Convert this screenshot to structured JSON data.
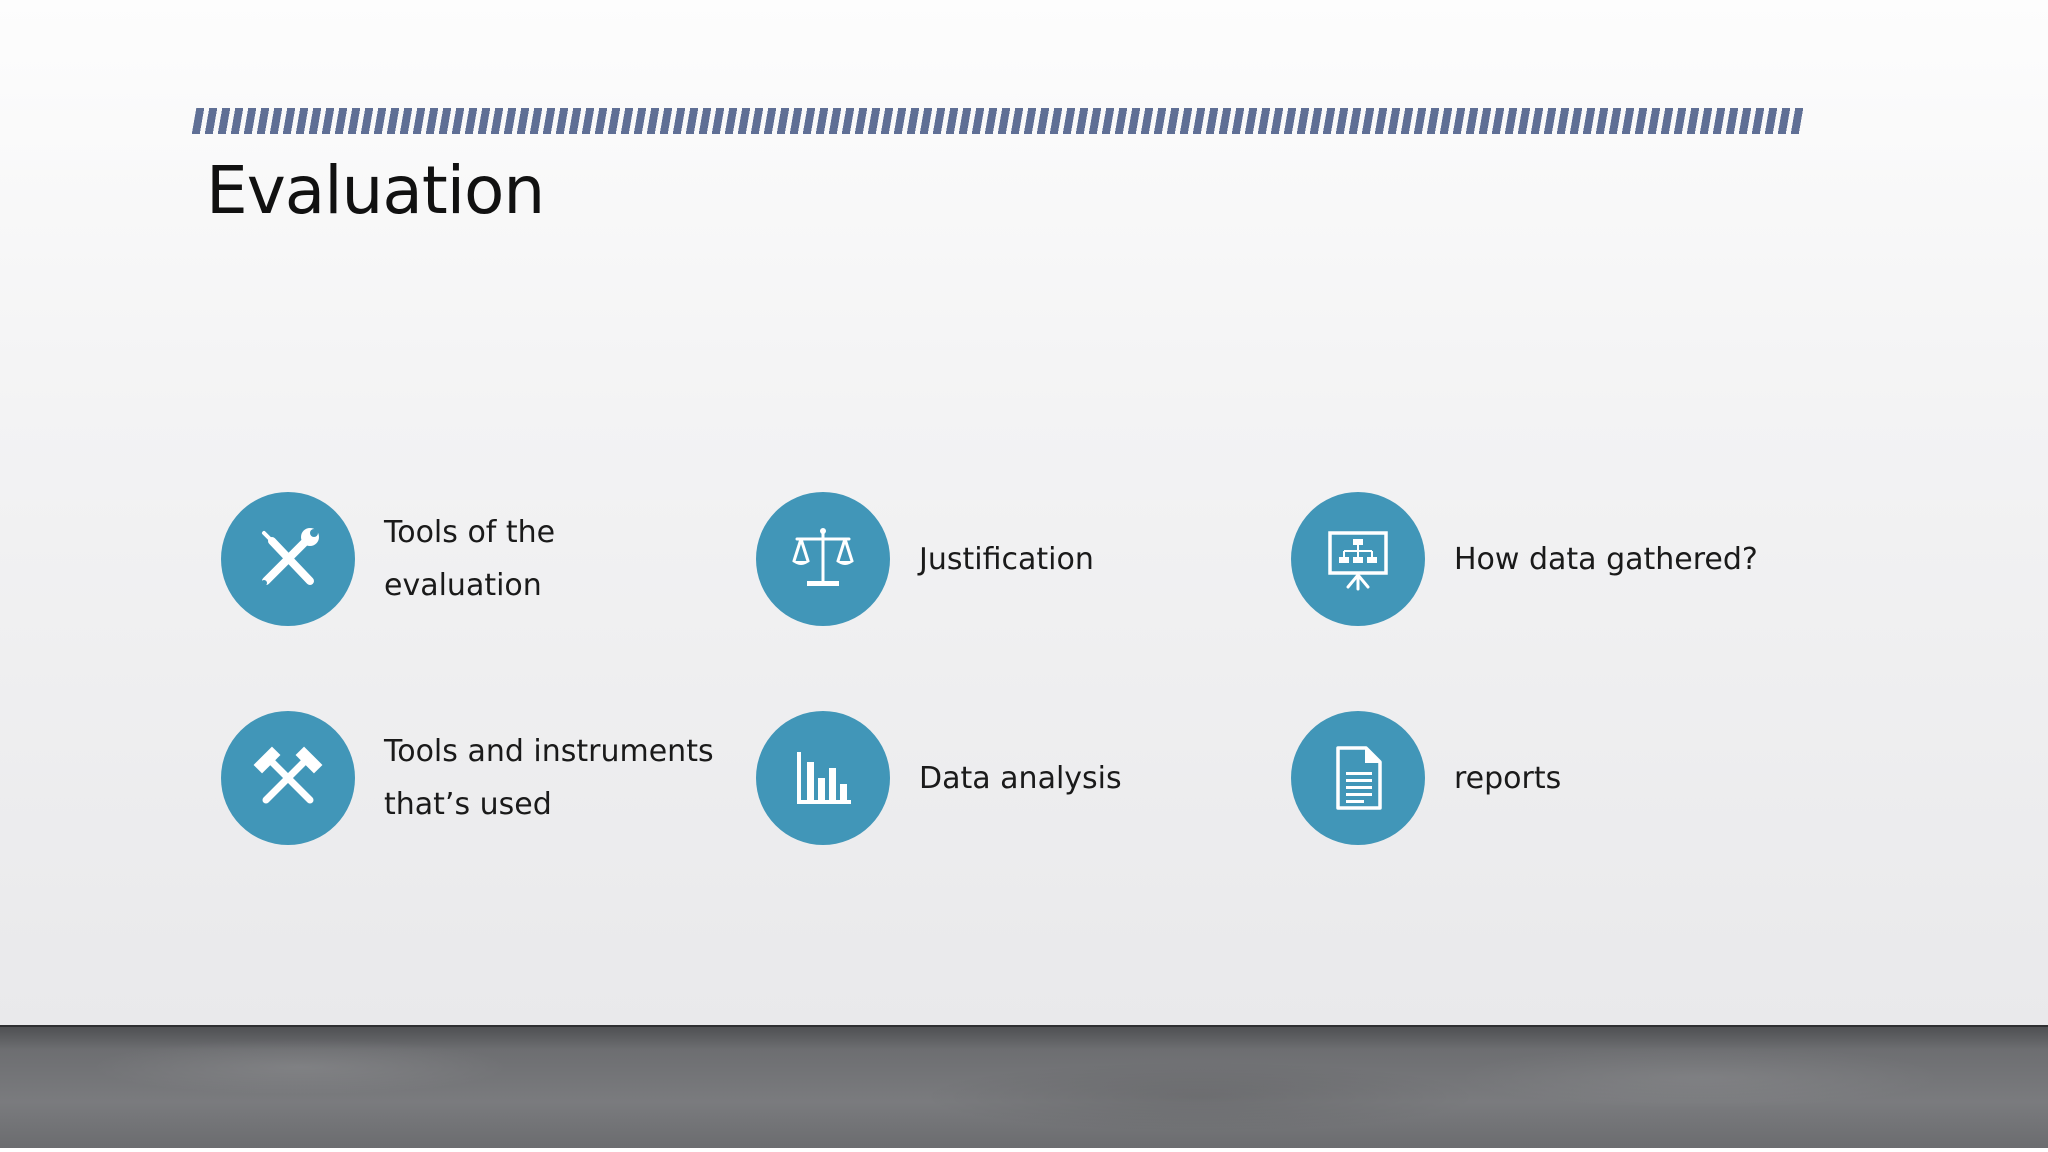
{
  "slide": {
    "title": "Evaluation",
    "items": [
      {
        "label": "Tools of the evaluation",
        "icon": "tools-icon"
      },
      {
        "label": "Justification",
        "icon": "scales-icon"
      },
      {
        "label": "How data gathered?",
        "icon": "presentation-board-icon"
      },
      {
        "label": "Tools and instruments that’s used",
        "icon": "hammers-icon"
      },
      {
        "label": "Data analysis",
        "icon": "bar-chart-icon"
      },
      {
        "label": "reports",
        "icon": "document-icon"
      }
    ]
  },
  "colors": {
    "accent": "#4196b8",
    "stripe": "#5f6f95",
    "title": "#111111"
  }
}
